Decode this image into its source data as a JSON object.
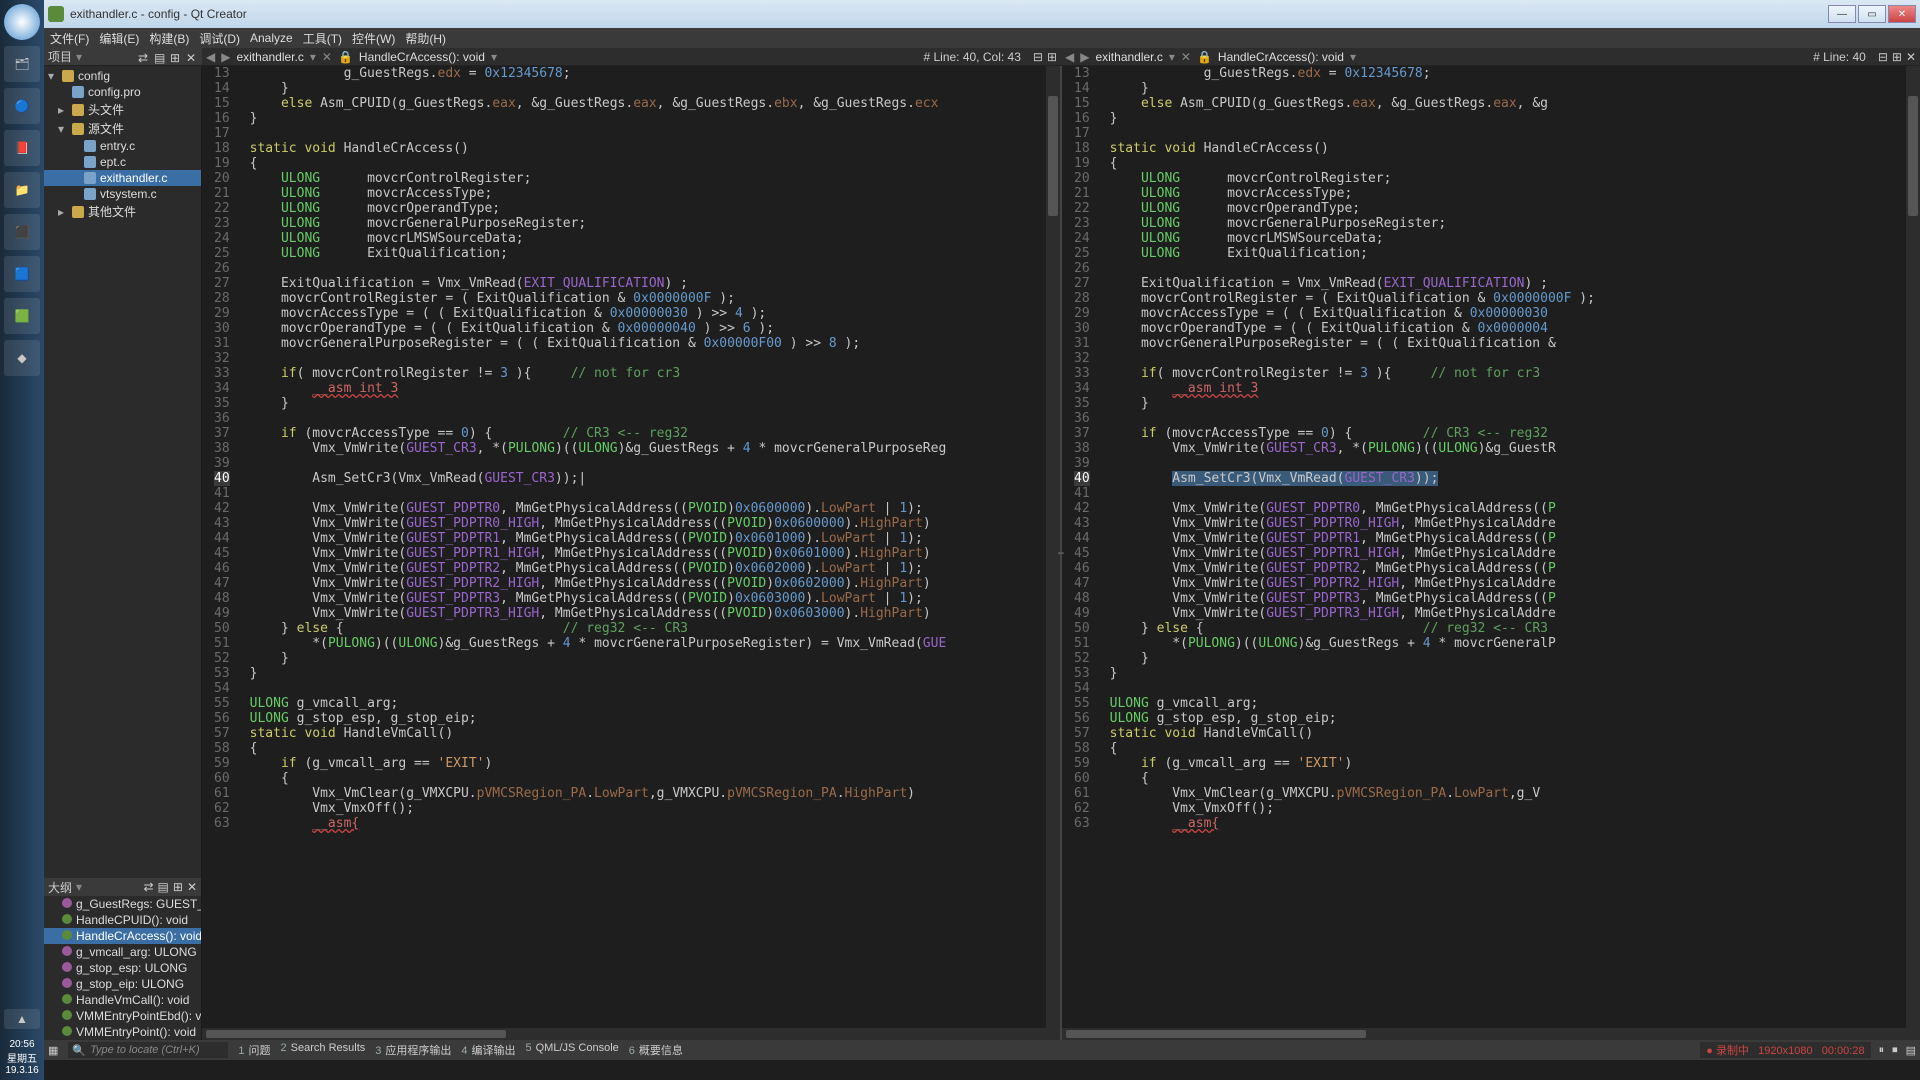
{
  "window": {
    "title": "exithandler.c - config - Qt Creator"
  },
  "menu": [
    "文件(F)",
    "编辑(E)",
    "构建(B)",
    "调试(D)",
    "Analyze",
    "工具(T)",
    "控件(W)",
    "帮助(H)"
  ],
  "project_header": "项目",
  "outline_header": "大纲",
  "tree": [
    {
      "depth": 0,
      "label": "config",
      "icon": "folder",
      "expanded": true
    },
    {
      "depth": 1,
      "label": "config.pro",
      "icon": "file"
    },
    {
      "depth": 1,
      "label": "头文件",
      "icon": "folder",
      "expanded": false
    },
    {
      "depth": 1,
      "label": "源文件",
      "icon": "folder",
      "expanded": true
    },
    {
      "depth": 2,
      "label": "entry.c",
      "icon": "file"
    },
    {
      "depth": 2,
      "label": "ept.c",
      "icon": "file"
    },
    {
      "depth": 2,
      "label": "exithandler.c",
      "icon": "file",
      "selected": true
    },
    {
      "depth": 2,
      "label": "vtsystem.c",
      "icon": "file"
    },
    {
      "depth": 1,
      "label": "其他文件",
      "icon": "folder",
      "expanded": false
    }
  ],
  "outline": [
    {
      "icon": "v",
      "label": "g_GuestRegs: GUEST_REGS"
    },
    {
      "icon": "f",
      "label": "HandleCPUID(): void"
    },
    {
      "icon": "f",
      "label": "HandleCrAccess(): void",
      "selected": true
    },
    {
      "icon": "v",
      "label": "g_vmcall_arg: ULONG"
    },
    {
      "icon": "v",
      "label": "g_stop_esp: ULONG"
    },
    {
      "icon": "v",
      "label": "g_stop_eip: ULONG"
    },
    {
      "icon": "f",
      "label": "HandleVmCall(): void"
    },
    {
      "icon": "f",
      "label": "VMMEntryPointEbd(): void"
    },
    {
      "icon": "f",
      "label": "VMMEntryPoint(): void"
    }
  ],
  "left_tab": {
    "file": "exithandler.c",
    "func": "HandleCrAccess(): void",
    "loc": "# Line: 40, Col: 43"
  },
  "right_tab": {
    "file": "exithandler.c",
    "func": "HandleCrAccess(): void",
    "loc": "# Line: 40"
  },
  "first_line": 13,
  "highlight_line": 40,
  "code_lines": [
    {
      "n": 13,
      "html": "            g_GuestRegs.<span class='mem'>edx</span> = <span class='num'>0x12345678</span>;"
    },
    {
      "n": 14,
      "html": "    }"
    },
    {
      "n": 15,
      "html": "    <span class='kw'>else</span> Asm_CPUID(g_GuestRegs.<span class='mem'>eax</span>, &g_GuestRegs.<span class='mem'>eax</span>, &g_GuestRegs.<span class='mem'>ebx</span>, &g_GuestRegs.<span class='mem'>ecx</span>"
    },
    {
      "n": 16,
      "html": "}"
    },
    {
      "n": 17,
      "html": ""
    },
    {
      "n": 18,
      "html": "<span class='kw'>static</span> <span class='kw'>void</span> <span class='fn'>HandleCrAccess</span>()"
    },
    {
      "n": 19,
      "html": "{"
    },
    {
      "n": 20,
      "html": "    <span class='ty'>ULONG</span>      movcrControlRegister;"
    },
    {
      "n": 21,
      "html": "    <span class='ty'>ULONG</span>      movcrAccessType;"
    },
    {
      "n": 22,
      "html": "    <span class='ty'>ULONG</span>      movcrOperandType;"
    },
    {
      "n": 23,
      "html": "    <span class='ty'>ULONG</span>      movcrGeneralPurposeRegister;"
    },
    {
      "n": 24,
      "html": "    <span class='ty'>ULONG</span>      movcrLMSWSourceData;"
    },
    {
      "n": 25,
      "html": "    <span class='ty'>ULONG</span>      ExitQualification;"
    },
    {
      "n": 26,
      "html": ""
    },
    {
      "n": 27,
      "html": "    ExitQualification = Vmx_VmRead(<span class='mac'>EXIT_QUALIFICATION</span>) ;"
    },
    {
      "n": 28,
      "html": "    movcrControlRegister = ( ExitQualification &amp; <span class='num'>0x0000000F</span> );"
    },
    {
      "n": 29,
      "html": "    movcrAccessType = ( ( ExitQualification &amp; <span class='num'>0x00000030</span> ) &gt;&gt; <span class='num'>4</span> );"
    },
    {
      "n": 30,
      "html": "    movcrOperandType = ( ( ExitQualification &amp; <span class='num'>0x00000040</span> ) &gt;&gt; <span class='num'>6</span> );"
    },
    {
      "n": 31,
      "html": "    movcrGeneralPurposeRegister = ( ( ExitQualification &amp; <span class='num'>0x00000F00</span> ) &gt;&gt; <span class='num'>8</span> );"
    },
    {
      "n": 32,
      "html": ""
    },
    {
      "n": 33,
      "html": "    <span class='kw'>if</span>( movcrControlRegister != <span class='num'>3</span> ){     <span class='cm'>// not for cr3</span>"
    },
    {
      "n": 34,
      "html": "        <span class='err'>__asm int 3</span>"
    },
    {
      "n": 35,
      "html": "    }"
    },
    {
      "n": 36,
      "html": ""
    },
    {
      "n": 37,
      "html": "    <span class='kw'>if</span> (movcrAccessType == <span class='num'>0</span>) {         <span class='cm'>// CR3 &lt;-- reg32</span>"
    },
    {
      "n": 38,
      "html": "        Vmx_VmWrite(<span class='mac'>GUEST_CR3</span>, *(<span class='ty'>PULONG</span>)((<span class='ty'>ULONG</span>)&amp;g_GuestRegs + <span class='num'>4</span> * movcrGeneralPurposeReg"
    },
    {
      "n": 39,
      "html": ""
    },
    {
      "n": 40,
      "html": "        Asm_SetCr3(Vmx_VmRead(<span class='mac'>GUEST_CR3</span>));|",
      "hl": true
    },
    {
      "n": 41,
      "html": ""
    },
    {
      "n": 42,
      "html": "        Vmx_VmWrite(<span class='mac'>GUEST_PDPTR0</span>, MmGetPhysicalAddress((<span class='ty'>PVOID</span>)<span class='num'>0x0600000</span>).<span class='mem'>LowPart</span> | <span class='num'>1</span>);"
    },
    {
      "n": 43,
      "html": "        Vmx_VmWrite(<span class='mac'>GUEST_PDPTR0_HIGH</span>, MmGetPhysicalAddress((<span class='ty'>PVOID</span>)<span class='num'>0x0600000</span>).<span class='mem'>HighPart</span>)"
    },
    {
      "n": 44,
      "html": "        Vmx_VmWrite(<span class='mac'>GUEST_PDPTR1</span>, MmGetPhysicalAddress((<span class='ty'>PVOID</span>)<span class='num'>0x0601000</span>).<span class='mem'>LowPart</span> | <span class='num'>1</span>);"
    },
    {
      "n": 45,
      "html": "        Vmx_VmWrite(<span class='mac'>GUEST_PDPTR1_HIGH</span>, MmGetPhysicalAddress((<span class='ty'>PVOID</span>)<span class='num'>0x0601000</span>).<span class='mem'>HighPart</span>)"
    },
    {
      "n": 46,
      "html": "        Vmx_VmWrite(<span class='mac'>GUEST_PDPTR2</span>, MmGetPhysicalAddress((<span class='ty'>PVOID</span>)<span class='num'>0x0602000</span>).<span class='mem'>LowPart</span> | <span class='num'>1</span>);"
    },
    {
      "n": 47,
      "html": "        Vmx_VmWrite(<span class='mac'>GUEST_PDPTR2_HIGH</span>, MmGetPhysicalAddress((<span class='ty'>PVOID</span>)<span class='num'>0x0602000</span>).<span class='mem'>HighPart</span>)"
    },
    {
      "n": 48,
      "html": "        Vmx_VmWrite(<span class='mac'>GUEST_PDPTR3</span>, MmGetPhysicalAddress((<span class='ty'>PVOID</span>)<span class='num'>0x0603000</span>).<span class='mem'>LowPart</span> | <span class='num'>1</span>);"
    },
    {
      "n": 49,
      "html": "        Vmx_VmWrite(<span class='mac'>GUEST_PDPTR3_HIGH</span>, MmGetPhysicalAddress((<span class='ty'>PVOID</span>)<span class='num'>0x0603000</span>).<span class='mem'>HighPart</span>)"
    },
    {
      "n": 50,
      "html": "    } <span class='kw'>else</span> {                            <span class='cm'>// reg32 &lt;-- CR3</span>"
    },
    {
      "n": 51,
      "html": "        *(<span class='ty'>PULONG</span>)((<span class='ty'>ULONG</span>)&amp;g_GuestRegs + <span class='num'>4</span> * movcrGeneralPurposeRegister) = Vmx_VmRead(<span class='mac'>GUE</span>"
    },
    {
      "n": 52,
      "html": "    }"
    },
    {
      "n": 53,
      "html": "}"
    },
    {
      "n": 54,
      "html": ""
    },
    {
      "n": 55,
      "html": "<span class='ty'>ULONG</span> g_vmcall_arg;"
    },
    {
      "n": 56,
      "html": "<span class='ty'>ULONG</span> g_stop_esp, g_stop_eip;"
    },
    {
      "n": 57,
      "html": "<span class='kw'>static</span> <span class='kw'>void</span> HandleVmCall()"
    },
    {
      "n": 58,
      "html": "{"
    },
    {
      "n": 59,
      "html": "    <span class='kw'>if</span> (g_vmcall_arg == <span class='str'>'EXIT'</span>)"
    },
    {
      "n": 60,
      "html": "    {"
    },
    {
      "n": 61,
      "html": "        Vmx_VmClear(g_VMXCPU.<span class='mem'>pVMCSRegion_PA</span>.<span class='mem'>LowPart</span>,g_VMXCPU.<span class='mem'>pVMCSRegion_PA</span>.<span class='mem'>HighPart</span>)"
    },
    {
      "n": 62,
      "html": "        Vmx_VmxOff();"
    },
    {
      "n": 63,
      "html": "        <span class='err'>__asm{</span>"
    }
  ],
  "right_code_overrides": {
    "15": "    <span class='kw'>else</span> Asm_CPUID(g_GuestRegs.<span class='mem'>eax</span>, &amp;g_GuestRegs.<span class='mem'>eax</span>, &amp;g",
    "29": "    movcrAccessType = ( ( ExitQualification &amp; <span class='num'>0x00000030</span>",
    "30": "    movcrOperandType = ( ( ExitQualification &amp; <span class='num'>0x0000004</span>",
    "31": "    movcrGeneralPurposeRegister = ( ( ExitQualification &amp;",
    "38": "        Vmx_VmWrite(<span class='mac'>GUEST_CR3</span>, *(<span class='ty'>PULONG</span>)((<span class='ty'>ULONG</span>)&amp;g_GuestR",
    "40": "        <span class='hlbg'>Asm_SetCr3(Vmx_VmRead(<span class='mac'>GUEST_CR3</span>));</span>",
    "42": "        Vmx_VmWrite(<span class='mac'>GUEST_PDPTR0</span>, MmGetPhysicalAddress((<span class='ty'>P</span>",
    "43": "        Vmx_VmWrite(<span class='mac'>GUEST_PDPTR0_HIGH</span>, MmGetPhysicalAddre",
    "44": "        Vmx_VmWrite(<span class='mac'>GUEST_PDPTR1</span>, MmGetPhysicalAddress((<span class='ty'>P</span>",
    "45": "        Vmx_VmWrite(<span class='mac'>GUEST_PDPTR1_HIGH</span>, MmGetPhysicalAddre",
    "46": "        Vmx_VmWrite(<span class='mac'>GUEST_PDPTR2</span>, MmGetPhysicalAddress((<span class='ty'>P</span>",
    "47": "        Vmx_VmWrite(<span class='mac'>GUEST_PDPTR2_HIGH</span>, MmGetPhysicalAddre",
    "48": "        Vmx_VmWrite(<span class='mac'>GUEST_PDPTR3</span>, MmGetPhysicalAddress((<span class='ty'>P</span>",
    "49": "        Vmx_VmWrite(<span class='mac'>GUEST_PDPTR3_HIGH</span>, MmGetPhysicalAddre",
    "51": "        *(<span class='ty'>PULONG</span>)((<span class='ty'>ULONG</span>)&amp;g_GuestRegs + <span class='num'>4</span> * movcrGeneralP",
    "61": "        Vmx_VmClear(g_VMXCPU.<span class='mem'>pVMCSRegion_PA</span>.<span class='mem'>LowPart</span>,g_V"
  },
  "locator_placeholder": "Type to locate (Ctrl+K)",
  "bottom_tabs": [
    {
      "k": "1",
      "label": "问题"
    },
    {
      "k": "2",
      "label": "Search Results"
    },
    {
      "k": "3",
      "label": "应用程序输出"
    },
    {
      "k": "4",
      "label": "编译输出"
    },
    {
      "k": "5",
      "label": "QML/JS Console"
    },
    {
      "k": "6",
      "label": "概要信息"
    }
  ],
  "recording": {
    "label": "录制中",
    "res": "1920x1080",
    "time": "00:00:28"
  },
  "clock": {
    "time": "20:56",
    "day": "星期五",
    "date": "19.3.16"
  }
}
